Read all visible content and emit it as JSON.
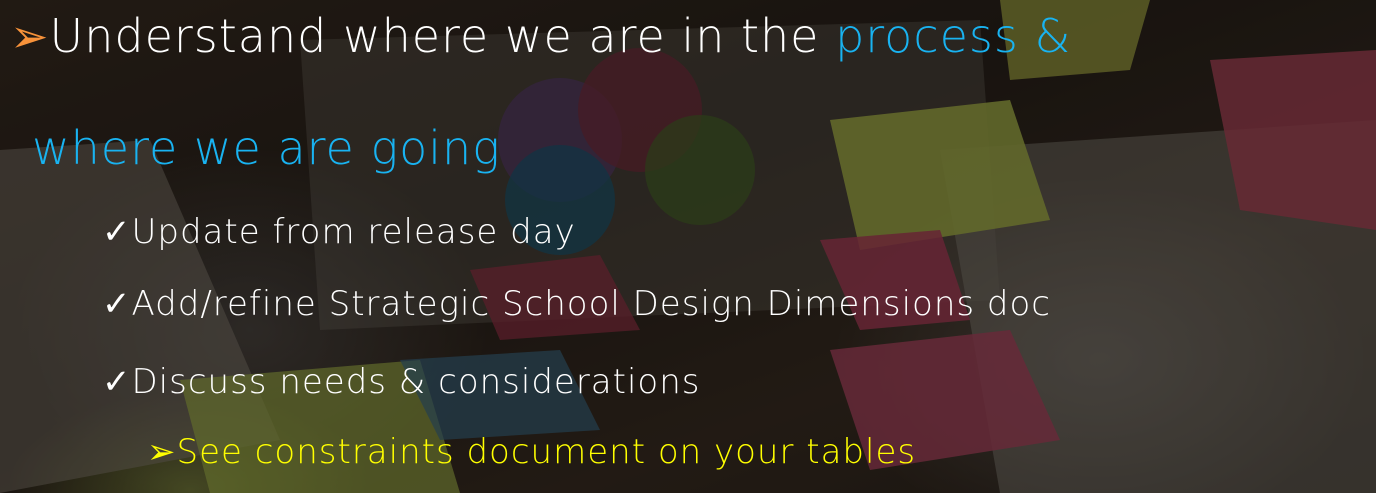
{
  "slide": {
    "line1": {
      "bullet": "➢",
      "text": "Understand where we are in the ",
      "highlight": "process &"
    },
    "line2": "where we are going",
    "items": [
      {
        "bullet": "✓",
        "text": "Update from release day"
      },
      {
        "bullet": "✓",
        "text": "Add/refine Strategic School Design Dimensions doc"
      },
      {
        "bullet": "✓",
        "text": "Discuss needs & considerations"
      }
    ],
    "sub_item": {
      "bullet": "➢",
      "text": "See constraints document on your tables"
    }
  },
  "colors": {
    "text": "#ffffff",
    "highlight_blue": "#19b3f1",
    "bullet_orange": "#f7923a",
    "sub_item_yellow": "#ffff00"
  }
}
